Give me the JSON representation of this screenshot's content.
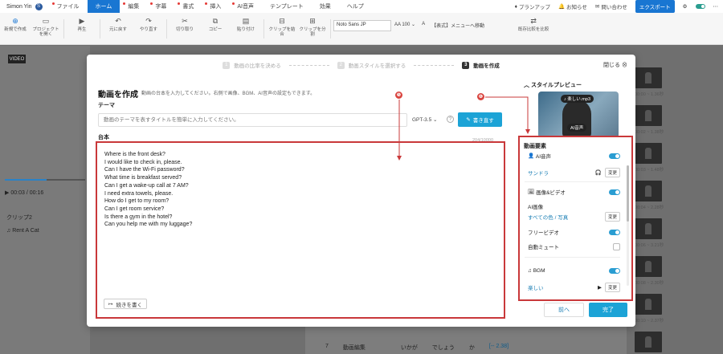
{
  "topbar": {
    "user_name": "Simon Yin",
    "avatar_initial": "S",
    "menus": [
      "ファイル",
      "ホーム",
      "編集",
      "字幕",
      "書式",
      "挿入",
      "AI音声",
      "テンプレート",
      "効果",
      "ヘルプ"
    ],
    "active_menu": "ホーム",
    "right": {
      "plan": "プランアップ",
      "notify": "お知らせ",
      "contact": "問い合わせ",
      "export": "エクスポート"
    }
  },
  "toolbar": {
    "buttons": [
      {
        "label": "新規で作成",
        "icon": "add-icon"
      },
      {
        "label": "プロジェクトを開く",
        "icon": "folder-icon"
      },
      {
        "label": "再生",
        "icon": "play-icon"
      },
      {
        "label": "元に戻す",
        "icon": "undo-icon"
      },
      {
        "label": "やり直す",
        "icon": "redo-icon"
      },
      {
        "label": "切り取り",
        "icon": "scissors-icon"
      },
      {
        "label": "コピー",
        "icon": "copy-icon"
      },
      {
        "label": "貼り付け",
        "icon": "paste-icon"
      },
      {
        "label": "クリップを結合",
        "icon": "merge-icon"
      },
      {
        "label": "クリップを分割",
        "icon": "split-icon"
      }
    ],
    "font": "Noto Sans JP",
    "font_size": "100",
    "menu_move": "【表式】メニューへ移動",
    "reset": "既存比較を比較"
  },
  "left": {
    "logo": "VIDEO",
    "time": "00:03",
    "duration": "/ 00:16",
    "clip_title": "クリップ2",
    "clip_item": "Rent A Cat"
  },
  "thumbs": {
    "labels": [
      "00:00 ~ 1.36秒",
      "00:02 ~ 1.38秒",
      "00:03 ~ 1.48秒",
      "00:04 ~ 2.28秒",
      "00:06 ~ 3.21秒",
      "00:08 ~ 2.30秒",
      "00:10 ~ 2.37秒",
      "00:12 ~ 2.01秒"
    ]
  },
  "bottom": {
    "n": "7",
    "label": "動画編集",
    "w1": "いかが",
    "w2": "でしょう",
    "w3": "か",
    "time": "[-- 2.38]"
  },
  "modal": {
    "steps": [
      {
        "n": "1",
        "label": "動画の比率を決める"
      },
      {
        "n": "2",
        "label": "動画スタイルを選択する"
      },
      {
        "n": "3",
        "label": "動画を作成"
      }
    ],
    "close": "閉じる",
    "title": "動画を作成",
    "subtitle": "動画の台本を入力してください。右側で画像、BGM、AI音声の設定もできます。",
    "theme_label": "テーマ",
    "theme_placeholder": "動画のテーマを表すタイトルを簡単に入力してください。",
    "model": "GPT-3.5",
    "rewrite": "書き直す",
    "script_label": "台本",
    "counter": "204/10000",
    "script_lines": [
      "Where is the front desk?",
      "I would like to check in, please.",
      "Can I have the Wi-Fi password?",
      "What time is breakfast served?",
      "Can I get a wake-up call at 7 AM?",
      "I need extra towels, please.",
      "How do I get to my room?",
      "Can I get room service?",
      "Is there a gym in the hotel?",
      "Can you help me with my luggage?"
    ],
    "continue": "続きを書く",
    "badge_script": "❺",
    "badge_elements": "❻",
    "preview_title": "スタイルプレビュー",
    "preview_chip": "楽しい.mp3",
    "preview_chip2": "AI音声",
    "elements_title": "動画要素",
    "ai_voice": {
      "label": "AI音声",
      "value": "サンドラ",
      "change": "変更"
    },
    "image_video": {
      "label": "画像&ビデオ"
    },
    "ai_image": {
      "label": "AI画像",
      "value": "すべての色 / 写真",
      "change": "変更"
    },
    "free_video": {
      "label": "フリービデオ"
    },
    "auto_mute": {
      "label": "自動ミュート"
    },
    "bgm": {
      "label": "BGM",
      "value": "楽しい",
      "change": "変更"
    },
    "back": "前へ",
    "done": "完了"
  },
  "colors": {
    "accent": "#1ca3d6",
    "highlight": "#c9383a"
  }
}
